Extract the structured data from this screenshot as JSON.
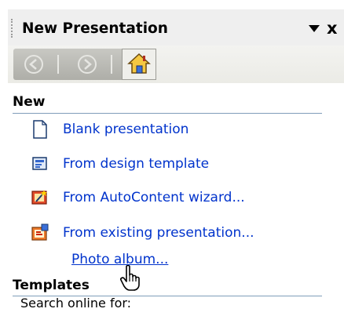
{
  "pane": {
    "title": "New Presentation",
    "dropdown_icon": "triangle-down-icon",
    "close_label": "x"
  },
  "nav": {
    "back_icon": "back-arrow-icon",
    "forward_icon": "forward-arrow-icon",
    "home_icon": "home-icon"
  },
  "new_section": {
    "heading": "New",
    "items": [
      {
        "label": "Blank presentation",
        "icon": "blank-page-icon"
      },
      {
        "label": "From design template",
        "icon": "design-template-icon"
      },
      {
        "label": "From AutoContent wizard...",
        "icon": "autocontent-wizard-icon"
      },
      {
        "label": "From existing presentation...",
        "icon": "existing-presentation-icon"
      },
      {
        "label": "Photo album..."
      }
    ]
  },
  "templates_section": {
    "heading": "Templates",
    "search_label": "Search online for:"
  },
  "colors": {
    "link": "#0033cc",
    "rule": "#7f9db9"
  }
}
